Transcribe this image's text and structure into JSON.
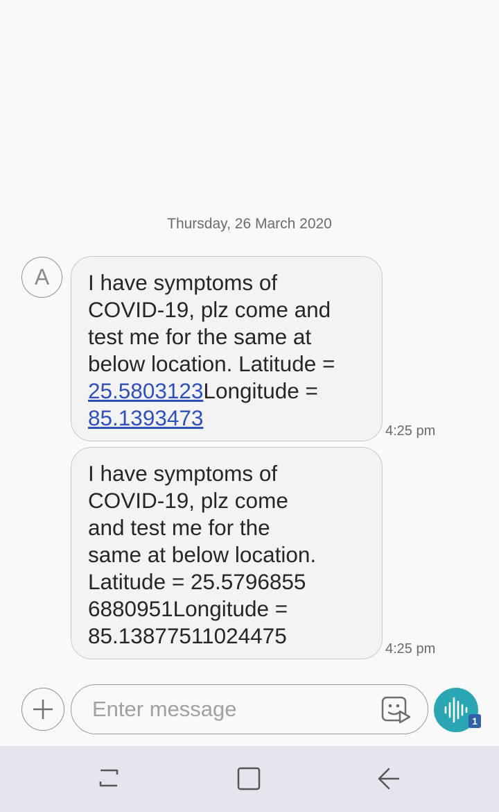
{
  "conversation": {
    "date_header": "Thursday, 26 March 2020",
    "contact_initial": "A",
    "messages": [
      {
        "lines": [
          {
            "parts": [
              {
                "text": "I have symptoms of",
                "link": false
              }
            ]
          },
          {
            "parts": [
              {
                "text": "COVID-19, plz come and",
                "link": false
              }
            ]
          },
          {
            "parts": [
              {
                "text": "test me for the same at",
                "link": false
              }
            ]
          },
          {
            "parts": [
              {
                "text": "below location. Latitude =",
                "link": false
              }
            ]
          },
          {
            "parts": [
              {
                "text": "25.5803123",
                "link": true
              },
              {
                "text": "Longitude =",
                "link": false
              }
            ]
          },
          {
            "parts": [
              {
                "text": "85.1393473",
                "link": true
              }
            ]
          }
        ],
        "time": "4:25 pm"
      },
      {
        "lines": [
          {
            "parts": [
              {
                "text": "I have symptoms of",
                "link": false
              }
            ]
          },
          {
            "parts": [
              {
                "text": "COVID-19, plz come",
                "link": false
              }
            ]
          },
          {
            "parts": [
              {
                "text": "and test me for the",
                "link": false
              }
            ]
          },
          {
            "parts": [
              {
                "text": "same at below location.",
                "link": false
              }
            ]
          },
          {
            "parts": [
              {
                "text": "Latitude = 25.5796855",
                "link": false
              }
            ]
          },
          {
            "parts": [
              {
                "text": "6880951Longitude =",
                "link": false
              }
            ]
          },
          {
            "parts": [
              {
                "text": "85.13877511024475",
                "link": false
              }
            ]
          }
        ],
        "time": "4:25 pm"
      }
    ]
  },
  "composer": {
    "placeholder": "Enter message",
    "value": "",
    "voice_badge": "1"
  },
  "icons": {
    "add": "plus-icon",
    "sticker": "sticker-icon",
    "voice": "voice-wave-icon",
    "nav_recent": "recent-apps-icon",
    "nav_home": "home-icon",
    "nav_back": "back-icon"
  },
  "colors": {
    "link": "#3050b8",
    "voice_button": "#2aa5b2",
    "badge": "#2f63a5"
  }
}
